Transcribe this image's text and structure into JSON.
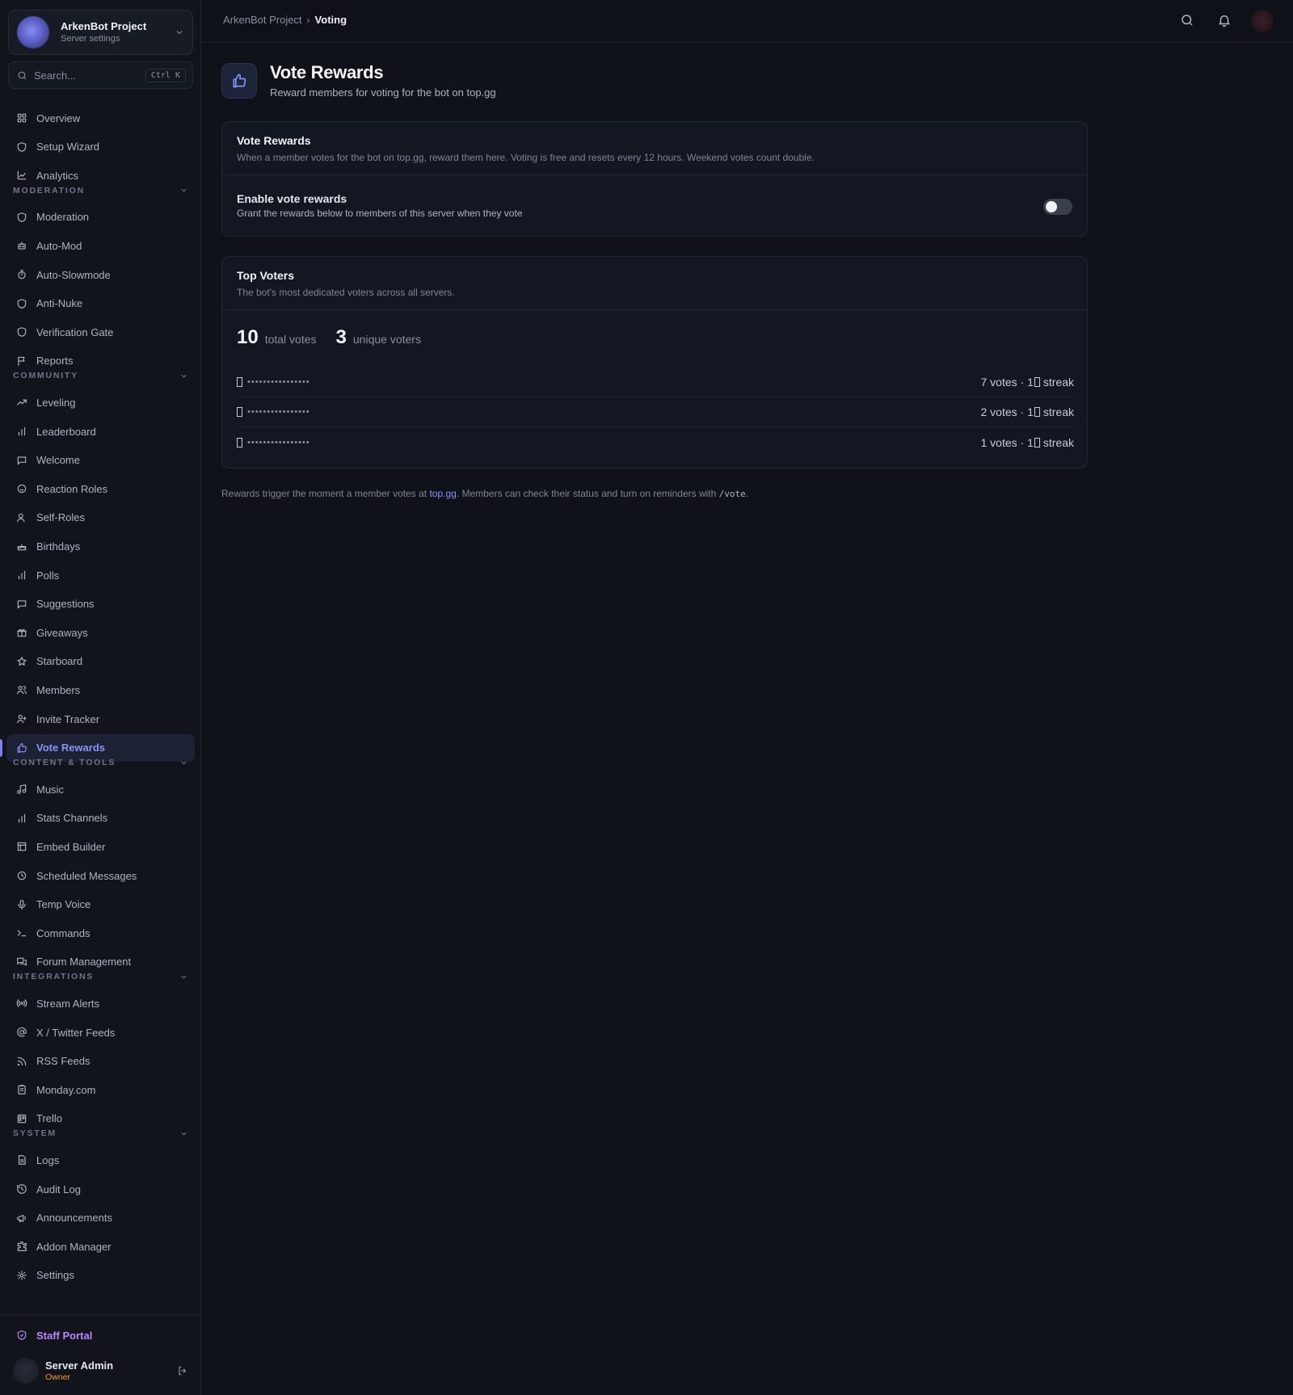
{
  "server": {
    "name": "ArkenBot Project",
    "subtitle": "Server settings"
  },
  "search": {
    "placeholder": "Search...",
    "shortcut": "Ctrl K"
  },
  "nav": {
    "top": [
      {
        "label": "Overview",
        "icon": "grid-icon"
      },
      {
        "label": "Setup Wizard",
        "icon": "shield-icon"
      },
      {
        "label": "Analytics",
        "icon": "chart-line-icon"
      }
    ],
    "sections": {
      "moderation": "MODERATION",
      "community": "COMMUNITY",
      "content_tools": "CONTENT & TOOLS",
      "integrations": "INTEGRATIONS",
      "system": "SYSTEM"
    },
    "moderation": [
      "Moderation",
      "Auto-Mod",
      "Auto-Slowmode",
      "Anti-Nuke",
      "Verification Gate",
      "Reports"
    ],
    "community": [
      "Leveling",
      "Leaderboard",
      "Welcome",
      "Reaction Roles",
      "Self-Roles",
      "Birthdays",
      "Polls",
      "Suggestions",
      "Giveaways",
      "Starboard",
      "Members",
      "Invite Tracker",
      "Vote Rewards"
    ],
    "content_tools": [
      "Music",
      "Stats Channels",
      "Embed Builder",
      "Scheduled Messages",
      "Temp Voice",
      "Commands",
      "Forum Management"
    ],
    "integrations": [
      "Stream Alerts",
      "X / Twitter Feeds",
      "RSS Feeds",
      "Monday.com",
      "Trello"
    ],
    "system": [
      "Logs",
      "Audit Log",
      "Announcements",
      "Addon Manager",
      "Settings"
    ],
    "active": "Vote Rewards"
  },
  "staff_portal": "Staff Portal",
  "user": {
    "name": "Server Admin",
    "role": "Owner"
  },
  "breadcrumb": {
    "parent": "ArkenBot Project",
    "current": "Voting"
  },
  "page": {
    "title": "Vote Rewards",
    "subtitle": "Reward members for voting for the bot on top.gg"
  },
  "rewards_card": {
    "title": "Vote Rewards",
    "description": "When a member votes for the bot on top.gg, reward them here. Voting is free and resets every 12 hours. Weekend votes count double.",
    "toggle_title": "Enable vote rewards",
    "toggle_desc": "Grant the rewards below to members of this server when they vote",
    "enabled": false
  },
  "top_voters": {
    "title": "Top Voters",
    "description": "The bot's most dedicated voters across all servers.",
    "total_votes": "10",
    "total_votes_label": "total votes",
    "unique_voters": "3",
    "unique_voters_label": "unique voters",
    "voters": [
      {
        "name": "••••••••••••••••",
        "votes": "7 votes · 1",
        "streak": "streak"
      },
      {
        "name": "••••••••••••••••",
        "votes": "2 votes · 1",
        "streak": "streak"
      },
      {
        "name": "••••••••••••••••",
        "votes": "1 votes · 1",
        "streak": "streak"
      }
    ]
  },
  "footer": {
    "before": "Rewards trigger the moment a member votes at ",
    "link": "top.gg",
    "middle": ". Members can check their status and turn on reminders with ",
    "command": "/vote",
    "after": "."
  },
  "colors": {
    "accent": "#7c83f5",
    "staff": "#c084fc",
    "owner": "#f59e0b",
    "background": "#0f1219"
  }
}
